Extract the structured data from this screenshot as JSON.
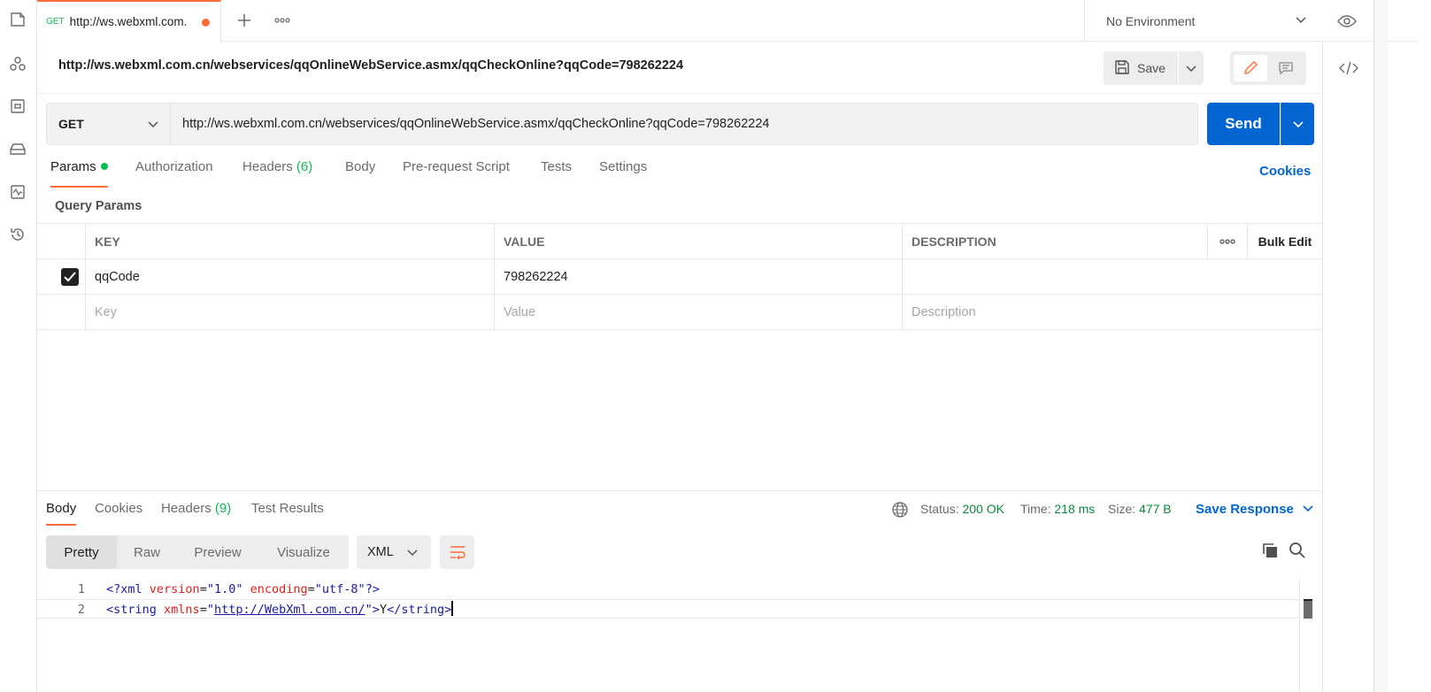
{
  "tab": {
    "method": "GET",
    "title": "http://ws.webxml.com."
  },
  "environment": {
    "selected": "No Environment"
  },
  "request": {
    "title": "http://ws.webxml.com.cn/webservices/qqOnlineWebService.asmx/qqCheckOnline?qqCode=798262224",
    "method": "GET",
    "url": "http://ws.webxml.com.cn/webservices/qqOnlineWebService.asmx/qqCheckOnline?qqCode=798262224",
    "save_label": "Save",
    "send_label": "Send"
  },
  "request_tabs": {
    "params": "Params",
    "authorization": "Authorization",
    "headers": "Headers",
    "headers_count": "(6)",
    "body": "Body",
    "prerequest": "Pre-request Script",
    "tests": "Tests",
    "settings": "Settings",
    "cookies": "Cookies"
  },
  "query_params": {
    "title": "Query Params",
    "columns": {
      "key": "KEY",
      "value": "VALUE",
      "description": "DESCRIPTION",
      "bulk_edit": "Bulk Edit"
    },
    "rows": [
      {
        "checked": true,
        "key": "qqCode",
        "value": "798262224",
        "description": ""
      }
    ],
    "placeholders": {
      "key": "Key",
      "value": "Value",
      "description": "Description"
    }
  },
  "response": {
    "tabs": {
      "body": "Body",
      "cookies": "Cookies",
      "headers": "Headers",
      "headers_count": "(9)",
      "test_results": "Test Results"
    },
    "status_label": "Status:",
    "status_value": "200 OK",
    "time_label": "Time:",
    "time_value": "218 ms",
    "size_label": "Size:",
    "size_value": "477 B",
    "save_response": "Save Response",
    "views": {
      "pretty": "Pretty",
      "raw": "Raw",
      "preview": "Preview",
      "visualize": "Visualize"
    },
    "format": "XML",
    "lines": [
      {
        "num": "1",
        "pi_open": "<?xml",
        "attr1": "version",
        "val1": "\"1.0\"",
        "attr2": "encoding",
        "val2": "\"utf-8\"",
        "pi_close": "?>"
      },
      {
        "num": "2",
        "tag_open": "<string",
        "attr": "xmlns",
        "eq": "=",
        "q1": "\"",
        "link": "http://WebXml.com.cn/",
        "q2": "\"",
        "gt": ">",
        "text": "Y",
        "tag_close": "</string>"
      }
    ]
  },
  "colors": {
    "accent": "#ff6c37",
    "primary": "#0265d2",
    "success": "#0cbb52"
  },
  "icons": [
    "collections-icon",
    "apis-icon",
    "environments-icon",
    "mock-servers-icon",
    "monitors-icon",
    "history-icon",
    "plus-icon",
    "more-icon",
    "chevron-down-icon",
    "eye-icon",
    "save-icon",
    "edit-icon",
    "comment-icon",
    "code-icon",
    "globe-icon",
    "wrap-icon",
    "copy-icon",
    "search-icon",
    "check-icon"
  ]
}
